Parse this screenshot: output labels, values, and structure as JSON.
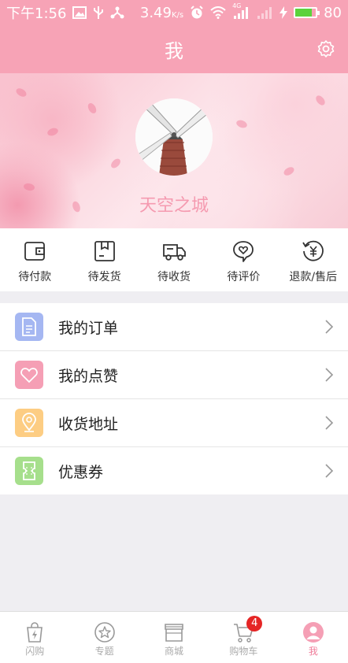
{
  "status_bar": {
    "time": "下午1:56",
    "speed": "3.49",
    "speed_unit": "K/s",
    "network": "4G",
    "battery": "80",
    "battery_level": 0.8
  },
  "header": {
    "title": "我"
  },
  "profile": {
    "username": "天空之城"
  },
  "orders": [
    {
      "label": "待付款",
      "icon": "wallet-icon"
    },
    {
      "label": "待发货",
      "icon": "package-icon"
    },
    {
      "label": "待收货",
      "icon": "truck-icon"
    },
    {
      "label": "待评价",
      "icon": "heart-chat-icon"
    },
    {
      "label": "退款/售后",
      "icon": "refund-icon"
    }
  ],
  "menu": [
    {
      "label": "我的订单",
      "icon": "document-icon",
      "color": "#a5b7f2"
    },
    {
      "label": "我的点赞",
      "icon": "heart-icon",
      "color": "#f59fb5"
    },
    {
      "label": "收货地址",
      "icon": "location-icon",
      "color": "#fdcd83"
    },
    {
      "label": "优惠券",
      "icon": "coupon-icon",
      "color": "#a6df8c"
    }
  ],
  "tabs": [
    {
      "label": "闪购",
      "icon": "flash-bag-icon"
    },
    {
      "label": "专题",
      "icon": "star-circle-icon"
    },
    {
      "label": "商城",
      "icon": "store-icon"
    },
    {
      "label": "购物车",
      "icon": "cart-icon",
      "badge": "4"
    },
    {
      "label": "我",
      "icon": "profile-icon",
      "active": true
    }
  ],
  "colors": {
    "theme_pink": "#f7a3b6",
    "active_tab": "#f07d9a",
    "badge": "#e52525"
  }
}
